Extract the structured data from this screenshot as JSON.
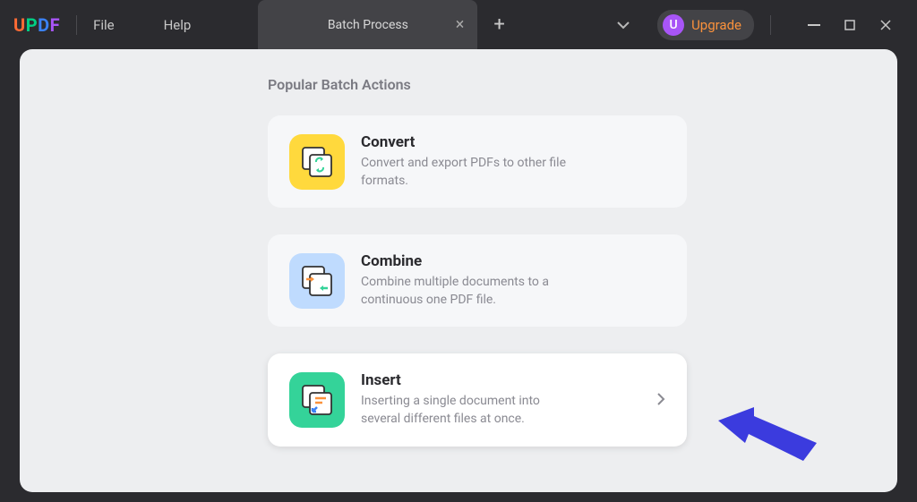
{
  "app": {
    "logo": {
      "u": "U",
      "p": "P",
      "d": "D",
      "f": "F"
    },
    "menu": {
      "file": "File",
      "help": "Help"
    },
    "tab": {
      "title": "Batch Process"
    },
    "upgrade": {
      "avatar": "U",
      "label": "Upgrade"
    }
  },
  "content": {
    "section_title": "Popular Batch Actions",
    "cards": [
      {
        "title": "Convert",
        "desc": "Convert and export PDFs to other file formats."
      },
      {
        "title": "Combine",
        "desc": "Combine multiple documents to a continuous one PDF file."
      },
      {
        "title": "Insert",
        "desc": "Inserting a single document into several different files at once."
      }
    ]
  }
}
